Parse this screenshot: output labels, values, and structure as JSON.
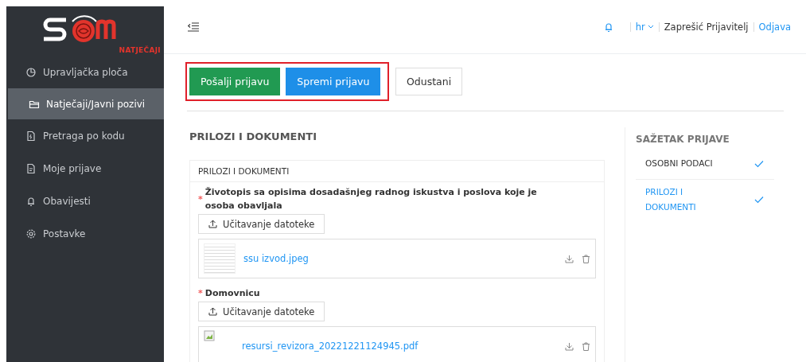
{
  "sidebar": {
    "logo": {
      "text": "NATJEČAJI"
    },
    "items": [
      {
        "label": "Upravljačka ploča",
        "selected": false
      },
      {
        "label": "Natječaji/Javni pozivi",
        "selected": true
      },
      {
        "label": "Pretraga po kodu",
        "selected": false
      },
      {
        "label": "Moje prijave",
        "selected": false
      },
      {
        "label": "Obavijesti",
        "selected": false
      },
      {
        "label": "Postavke",
        "selected": false
      }
    ]
  },
  "header": {
    "language": "hr",
    "user": "Zaprešić Prijavitelj",
    "logout": "Odjava"
  },
  "toolbar": {
    "buttons": [
      {
        "label": "Pošalji prijavu",
        "kind": "success",
        "highlighted": true
      },
      {
        "label": "Spremi prijavu",
        "kind": "primary",
        "highlighted": true
      },
      {
        "label": "Odustani",
        "kind": "default",
        "highlighted": false
      }
    ]
  },
  "section_title": "PRILOZI I DOKUMENTI",
  "card": {
    "title": "PRILOZI I DOKUMENTI",
    "fields": [
      {
        "label": "Životopis sa opisima dosadašnjeg radnog iskustva i poslova koje je osoba obavljala",
        "required_mark": "*",
        "upload_label": "Učitavanje datoteke",
        "files": [
          {
            "name": "ssu izvod.jpeg"
          }
        ]
      },
      {
        "label": "Domovnicu",
        "required_mark": "*",
        "upload_label": "Učitavanje datoteke",
        "files": [
          {
            "name": "resursi_revizora_20221221124945.pdf"
          }
        ]
      }
    ]
  },
  "summary": {
    "title": "SAŽETAK PRIJAVE",
    "items": [
      {
        "label": "OSOBNI PODACI",
        "selected": false,
        "done": true
      },
      {
        "label": "PRILOZI I DOKUMENTI",
        "selected": true,
        "done": true
      }
    ]
  }
}
